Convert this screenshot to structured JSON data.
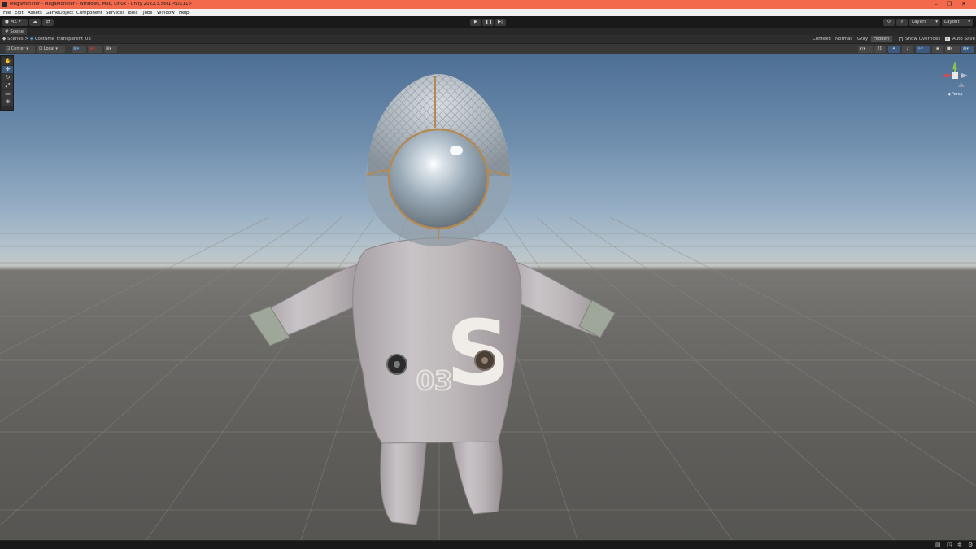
{
  "window": {
    "title": "MegaMonster - MegaMonster - Windows, Mac, Linux - Unity 2022.3.56f1 <DX11>",
    "minimize_glyph": "–",
    "maximize_glyph": "❐",
    "close_glyph": "✕"
  },
  "menu": {
    "items": [
      "File",
      "Edit",
      "Assets",
      "GameObject",
      "Component",
      "Services",
      "Tools",
      "Jobs",
      "Window",
      "Help"
    ]
  },
  "toolbar": {
    "account_label": "MZ",
    "layers_label": "Layers",
    "layout_label": "Layout"
  },
  "scene_tab": {
    "label": "Scene"
  },
  "breadcrumb": {
    "root": "Scenes",
    "separator": ">",
    "current": "Costume_transparent_03"
  },
  "context": {
    "label": "Context:",
    "options": [
      "Normal",
      "Gray",
      "Hidden"
    ],
    "selected": "Hidden",
    "show_overrides_label": "Show Overrides",
    "auto_save_label": "Auto Save",
    "auto_save_checked": true
  },
  "scene_options": {
    "pivot_label": "Center",
    "space_label": "Local",
    "mode_2d_label": "2D"
  },
  "gizmo": {
    "projection_label": "◀ Persp"
  },
  "model": {
    "chest_letter": "S",
    "chest_number": "03"
  },
  "colors": {
    "title_bar": "#f26a4b",
    "sky_top": "#4d6f94",
    "ground": "#6e6d6a"
  }
}
